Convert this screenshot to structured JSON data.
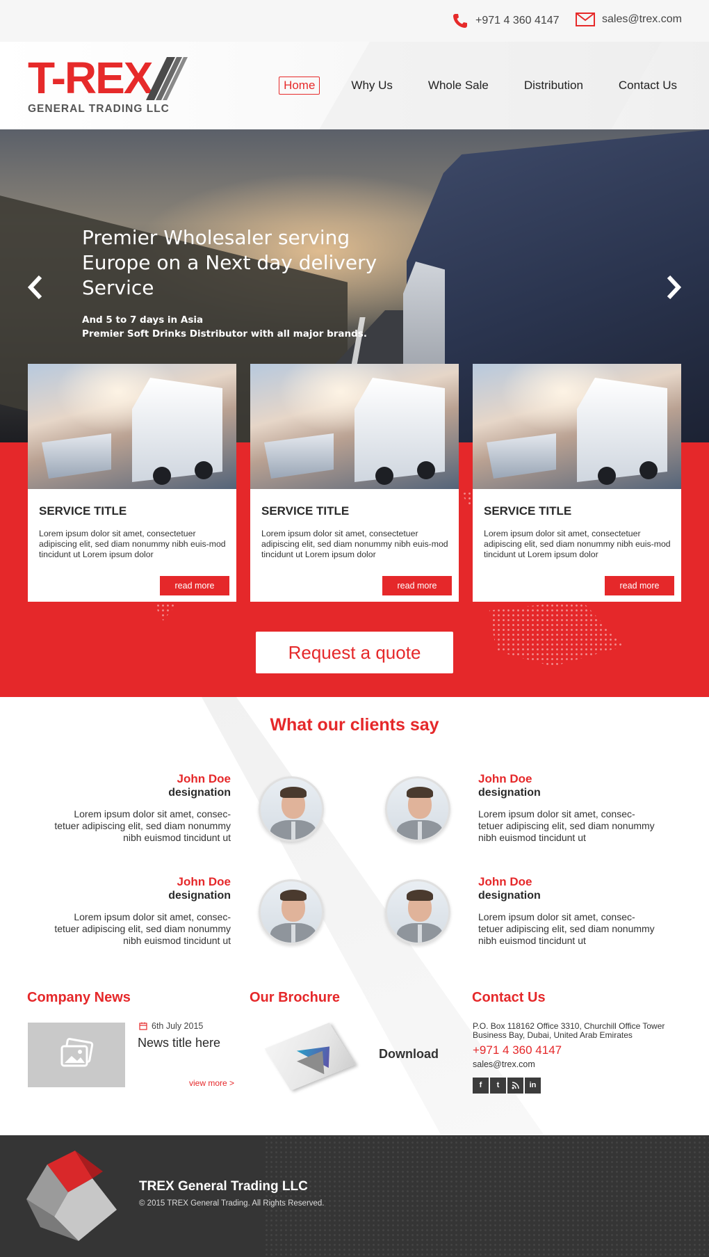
{
  "topbar": {
    "phone": "+971 4 360 4147",
    "email": "sales@trex.com"
  },
  "brand": {
    "logo_text": "T-REX",
    "logo_sub": "GENERAL TRADING LLC"
  },
  "nav": [
    {
      "label": "Home",
      "active": true
    },
    {
      "label": "Why Us"
    },
    {
      "label": "Whole Sale"
    },
    {
      "label": "Distribution"
    },
    {
      "label": "Contact Us"
    }
  ],
  "hero": {
    "headline": "Premier Wholesaler serving Europe on a Next day delivery Service",
    "sub1": "And 5 to 7 days in Asia",
    "sub2": "Premier Soft Drinks Distributor with all major brands."
  },
  "services": [
    {
      "title": "SERVICE TITLE",
      "text": "Lorem ipsum dolor sit amet, consectetuer adipiscing elit, sed diam nonummy nibh euis-mod tincidunt ut Lorem ipsum dolor",
      "button": "read more"
    },
    {
      "title": "SERVICE TITLE",
      "text": "Lorem ipsum dolor sit amet, consectetuer adipiscing elit, sed diam nonummy nibh euis-mod tincidunt ut Lorem ipsum dolor",
      "button": "read more"
    },
    {
      "title": "SERVICE TITLE",
      "text": "Lorem ipsum dolor sit amet, consectetuer adipiscing elit, sed diam nonummy nibh euis-mod tincidunt ut Lorem ipsum dolor",
      "button": "read more"
    }
  ],
  "quote_button": "Request a quote",
  "testimonials": {
    "title": "What our clients say",
    "items": [
      {
        "name": "John Doe",
        "designation": "designation",
        "text": "Lorem ipsum dolor sit amet, consec-tetuer adipiscing elit, sed diam nonummy nibh euismod tincidunt ut"
      },
      {
        "name": "John Doe",
        "designation": "designation",
        "text": "Lorem ipsum dolor sit amet, consec-tetuer adipiscing elit, sed diam nonummy nibh euismod tincidunt ut"
      },
      {
        "name": "John Doe",
        "designation": "designation",
        "text": "Lorem ipsum dolor sit amet, consec-tetuer adipiscing elit, sed diam nonummy nibh euismod tincidunt ut"
      },
      {
        "name": "John Doe",
        "designation": "designation",
        "text": "Lorem ipsum dolor sit amet, consec-tetuer adipiscing elit, sed diam nonummy nibh euismod tincidunt ut"
      }
    ]
  },
  "news": {
    "title": "Company News",
    "date": "6th July 2015",
    "headline": "News title here",
    "view_more": "view more >"
  },
  "brochure": {
    "title": "Our Brochure",
    "download": "Download"
  },
  "contact": {
    "title": "Contact Us",
    "address": "P.O. Box 118162 Office 3310, Churchill Office Tower Business Bay, Dubai, United Arab Emirates",
    "phone": "+971 4 360 4147",
    "email": "sales@trex.com",
    "social": [
      "f",
      "t",
      "rss",
      "in"
    ]
  },
  "footer": {
    "company": "TREX General Trading LLC",
    "copyright": "©   2015 TREX General Trading. All Rights Reserved."
  },
  "colors": {
    "accent": "#e5282a",
    "footer_bg": "#353535",
    "topbar_bg": "#f6f6f6"
  }
}
